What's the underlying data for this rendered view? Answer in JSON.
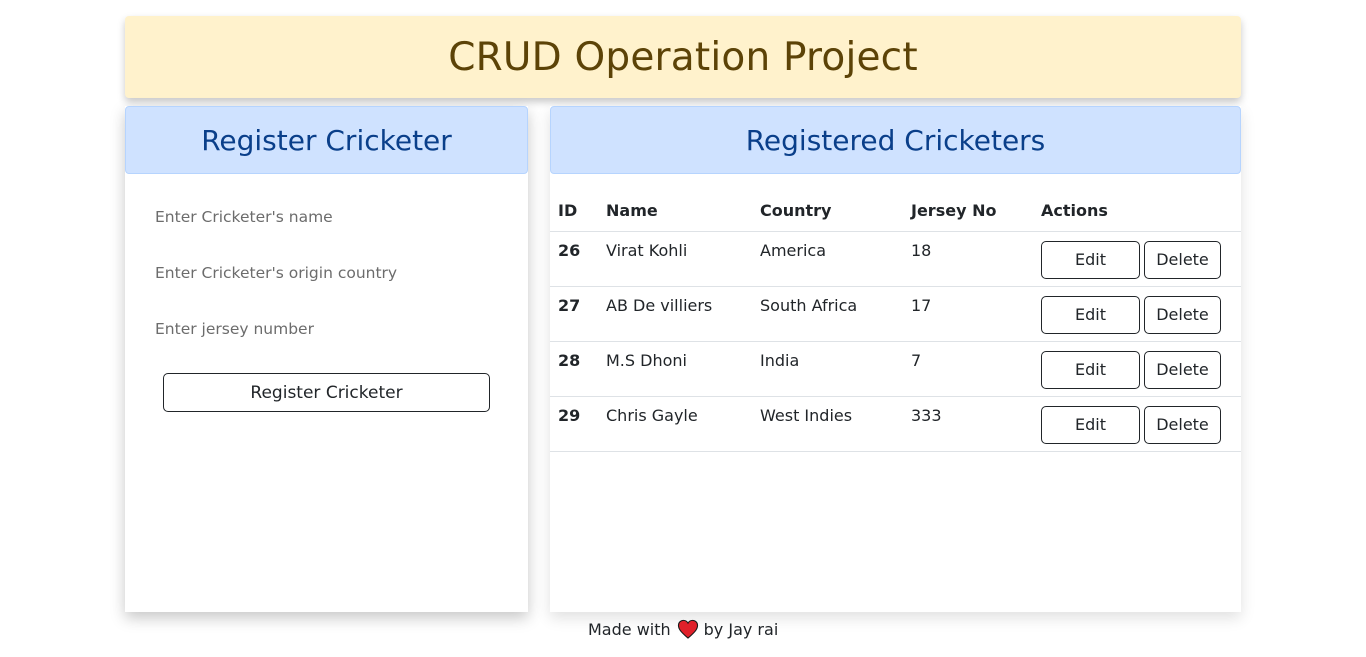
{
  "header": {
    "title": "CRUD Operation Project"
  },
  "form": {
    "title": "Register Cricketer",
    "name_placeholder": "Enter Cricketer's name",
    "country_placeholder": "Enter Cricketer's origin country",
    "jersey_placeholder": "Enter jersey number",
    "submit_label": "Register Cricketer"
  },
  "list": {
    "title": "Registered Cricketers",
    "columns": [
      "ID",
      "Name",
      "Country",
      "Jersey No",
      "Actions"
    ],
    "rows": [
      {
        "id": "26",
        "name": "Virat Kohli",
        "country": "America",
        "jersey": "18"
      },
      {
        "id": "27",
        "name": "AB De villiers",
        "country": "South Africa",
        "jersey": "17"
      },
      {
        "id": "28",
        "name": "M.S Dhoni",
        "country": "India",
        "jersey": "7"
      },
      {
        "id": "29",
        "name": "Chris Gayle",
        "country": "West Indies",
        "jersey": "333"
      }
    ],
    "edit_label": "Edit",
    "delete_label": "Delete"
  },
  "footer": {
    "prefix": "Made with",
    "icon": "heart-icon",
    "suffix": "by Jay rai"
  },
  "colors": {
    "header_bg": "#fff2cc",
    "header_text": "#5c4307",
    "panel_title_bg": "#cfe2ff",
    "panel_title_text": "#0a3f8a",
    "heart": "#e0202a"
  }
}
